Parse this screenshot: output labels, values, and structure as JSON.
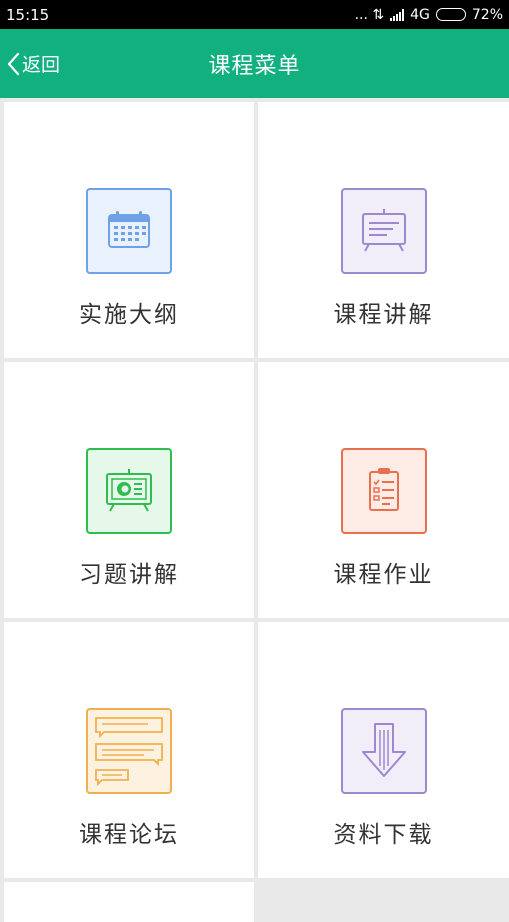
{
  "status_bar": {
    "time": "15:15",
    "indicators": "... ⇅",
    "network": "4G",
    "battery": "72%",
    "battery_level": 0.72
  },
  "nav": {
    "back_label": "返回",
    "title": "课程菜单",
    "color": "#13b07f"
  },
  "menu": [
    {
      "label": "实施大纲",
      "icon": "calendar-icon",
      "color": "#6fa1e6",
      "fill": "#e8f1fc"
    },
    {
      "label": "课程讲解",
      "icon": "presentation-board-icon",
      "color": "#9a8bd0",
      "fill": "#f1eefa"
    },
    {
      "label": "习题讲解",
      "icon": "tv-screen-icon",
      "color": "#2fbd4e",
      "fill": "#e5f8e9"
    },
    {
      "label": "课程作业",
      "icon": "clipboard-icon",
      "color": "#e8704f",
      "fill": "#fdece5"
    },
    {
      "label": "课程论坛",
      "icon": "chat-bubbles-icon",
      "color": "#f1b050",
      "fill": "#fdf2e0"
    },
    {
      "label": "资料下载",
      "icon": "download-arrow-icon",
      "color": "#9a8bd0",
      "fill": "#f1eefa"
    }
  ]
}
